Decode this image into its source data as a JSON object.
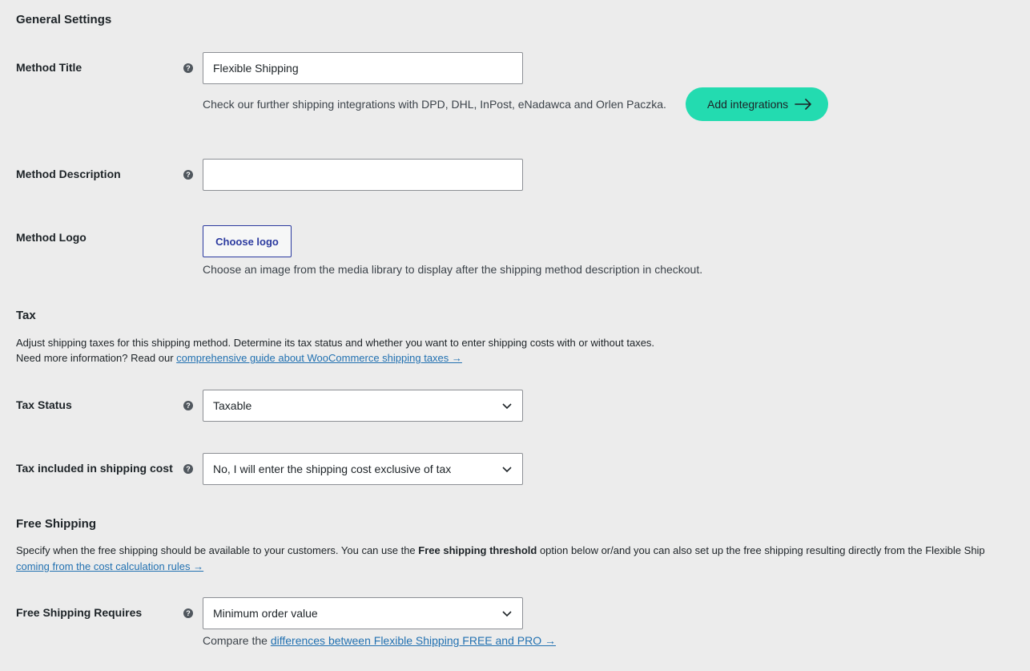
{
  "general": {
    "heading": "General Settings",
    "method_title": {
      "label": "Method Title",
      "value": "Flexible Shipping",
      "note": "Check our further shipping integrations with DPD, DHL, InPost, eNadawca and Orlen Paczka.",
      "button": "Add integrations"
    },
    "method_description": {
      "label": "Method Description",
      "value": ""
    },
    "method_logo": {
      "label": "Method Logo",
      "button": "Choose logo",
      "note": "Choose an image from the media library to display after the shipping method description in checkout."
    }
  },
  "tax": {
    "heading": "Tax",
    "intro_line1": "Adjust shipping taxes for this shipping method. Determine its tax status and whether you want to enter shipping costs with or without taxes.",
    "intro_line2_prefix": "Need more information? Read our ",
    "intro_link": "comprehensive guide about WooCommerce shipping taxes →",
    "status": {
      "label": "Tax Status",
      "value": "Taxable"
    },
    "included": {
      "label": "Tax included in shipping cost",
      "value": "No, I will enter the shipping cost exclusive of tax"
    }
  },
  "free_shipping": {
    "heading": "Free Shipping",
    "intro_prefix": "Specify when the free shipping should be available to your customers. You can use the ",
    "intro_bold": "Free shipping threshold",
    "intro_suffix": " option below or/and you can also set up the free shipping resulting directly from the Flexible Ship",
    "intro_link": "coming from the cost calculation rules →",
    "requires": {
      "label": "Free Shipping Requires",
      "value": "Minimum order value",
      "note_prefix": "Compare the ",
      "note_link": "differences between Flexible Shipping FREE and PRO →"
    }
  },
  "icons": {
    "help": "?",
    "arrow": "arrow-right-icon",
    "chevron": "chevron-down-icon"
  },
  "colors": {
    "accent_green": "#23dbb0",
    "link": "#2271b1",
    "outline_button": "#2b3a9f"
  }
}
